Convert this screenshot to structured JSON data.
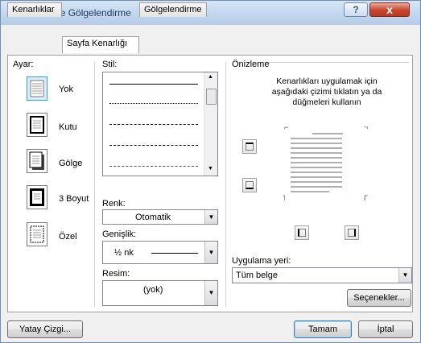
{
  "window": {
    "title": "Kenarlıklar ve Gölgelendirme",
    "help_label": "?",
    "close_label": "x"
  },
  "tabs": [
    {
      "label": "Kenarlıklar",
      "active": false
    },
    {
      "label": "Sayfa Kenarlığı",
      "active": true
    },
    {
      "label": "Gölgelendirme",
      "active": false
    }
  ],
  "settings": {
    "heading": "Ayar:",
    "items": [
      {
        "label": "Yok",
        "icon": "setting-none-icon",
        "selected": true
      },
      {
        "label": "Kutu",
        "icon": "setting-box-icon",
        "selected": false
      },
      {
        "label": "Gölge",
        "icon": "setting-shadow-icon",
        "selected": false
      },
      {
        "label": "3 Boyut",
        "icon": "setting-3d-icon",
        "selected": false
      },
      {
        "label": "Özel",
        "icon": "setting-custom-icon",
        "selected": false
      }
    ]
  },
  "style": {
    "heading": "Stil:",
    "items": [
      "solid",
      "dotted",
      "dashed-small",
      "dashed-large",
      "dash-dot"
    ]
  },
  "color": {
    "label": "Renk:",
    "value": "Otomatik"
  },
  "width": {
    "label": "Genişlik:",
    "value": "½ nk"
  },
  "art": {
    "label": "Resim:",
    "value": "(yok)"
  },
  "preview": {
    "heading": "Önizleme",
    "instructions": "Kenarlıkları uygulamak için aşağıdaki çizimi tıklatın ya da düğmeleri kullanın"
  },
  "apply_to": {
    "label": "Uygulama yeri:",
    "value": "Tüm belge"
  },
  "buttons": {
    "options": "Seçenekler...",
    "horizontal_line": "Yatay Çizgi...",
    "ok": "Tamam",
    "cancel": "İptal"
  },
  "colors": {
    "title_bar": "#b9d1ec",
    "selection": "#dbeeff",
    "close_button": "#c7432b"
  }
}
